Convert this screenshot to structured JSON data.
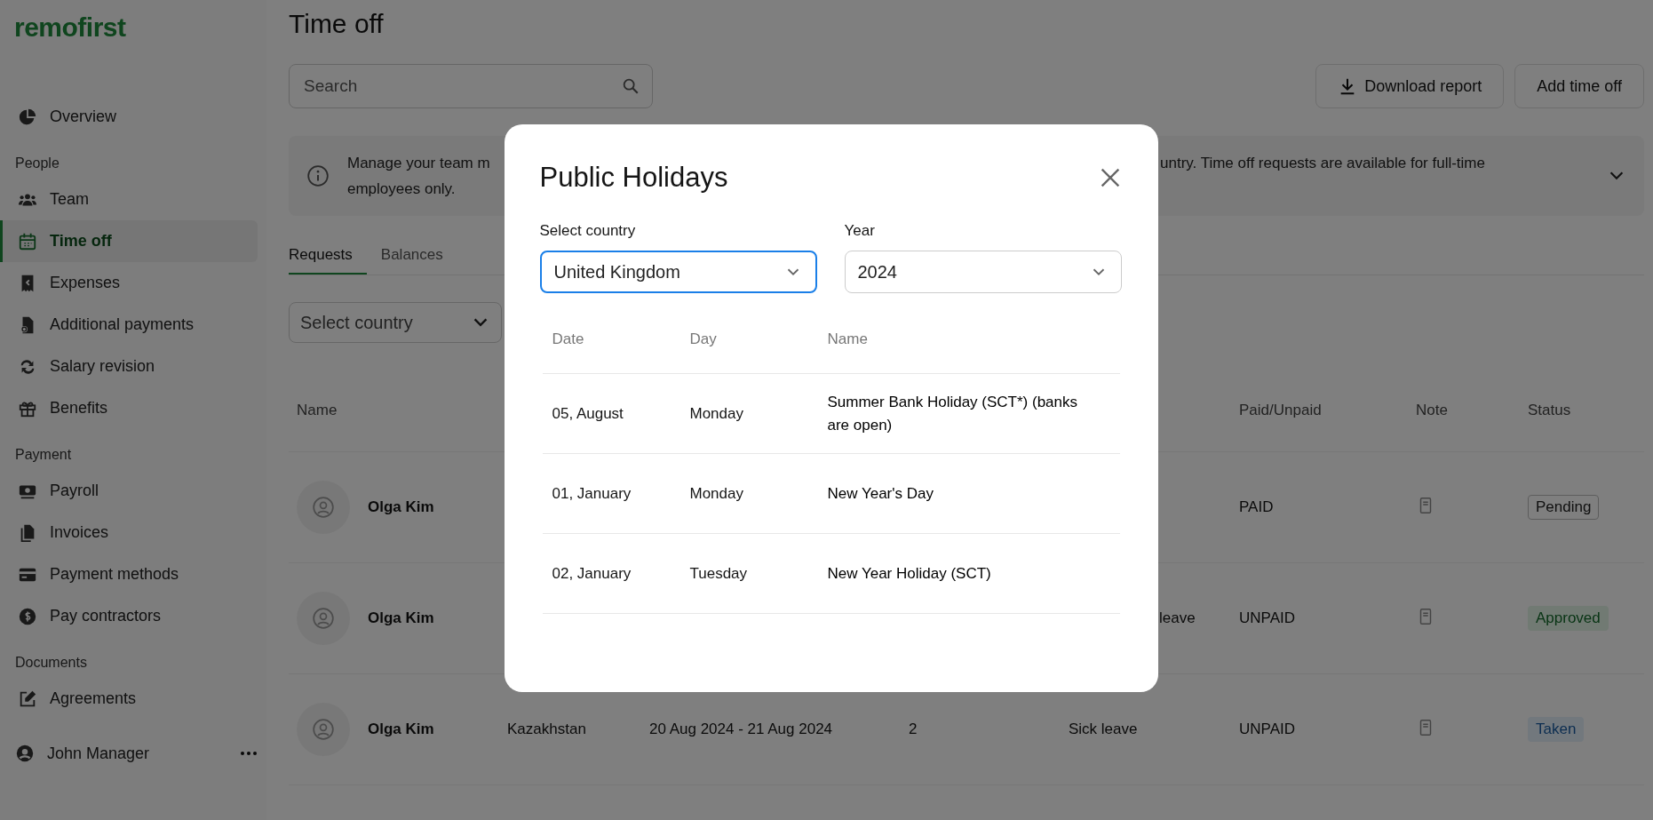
{
  "brand": {
    "logo": "remofirst"
  },
  "sidebar": {
    "sections": [
      {
        "items": [
          {
            "label": "Overview",
            "selected": false
          }
        ]
      },
      {
        "title": "People",
        "items": [
          {
            "label": "Team",
            "selected": false
          },
          {
            "label": "Time off",
            "selected": true
          },
          {
            "label": "Expenses",
            "selected": false
          },
          {
            "label": "Additional payments",
            "selected": false
          },
          {
            "label": "Salary revision",
            "selected": false
          },
          {
            "label": "Benefits",
            "selected": false
          }
        ]
      },
      {
        "title": "Payment",
        "items": [
          {
            "label": "Payroll",
            "selected": false
          },
          {
            "label": "Invoices",
            "selected": false
          },
          {
            "label": "Payment methods",
            "selected": false
          },
          {
            "label": "Pay contractors",
            "selected": false
          }
        ]
      },
      {
        "title": "Documents",
        "items": [
          {
            "label": "Agreements",
            "selected": false
          }
        ]
      }
    ],
    "user": {
      "name": "John Manager"
    }
  },
  "page": {
    "title": "Time off",
    "search": {
      "placeholder": "Search"
    },
    "buttons": [
      {
        "label": "Download report",
        "kind": "download"
      },
      {
        "label": "Add time off",
        "kind": "plain"
      }
    ],
    "banner": {
      "line1_start": "Manage your team m",
      "line1_end": "untry. Time off requests are available for full-time",
      "line2": "employees only."
    },
    "tabs": [
      {
        "label": "Requests",
        "selected": true
      },
      {
        "label": "Balances",
        "selected": false
      }
    ],
    "filter": {
      "placeholder": "Select country"
    }
  },
  "table": {
    "header": {
      "name": "Name",
      "paid": "Paid/Unpaid",
      "note": "Note",
      "status": "Status"
    },
    "rows": [
      {
        "name": "Olga Kim",
        "paid": "PAID",
        "status": "Pending",
        "kind": "pending"
      },
      {
        "name": "Olga Kim",
        "type": "leave",
        "type_cut": true,
        "paid": "UNPAID",
        "status": "Approved",
        "kind": "approved"
      },
      {
        "name": "Olga Kim",
        "country": "Kazakhstan",
        "dates": "20 Aug 2024 - 21 Aug 2024",
        "days": "2",
        "type": "Sick leave",
        "type_cut": false,
        "paid": "UNPAID",
        "status": "Taken",
        "kind": "taken"
      }
    ]
  },
  "modal": {
    "title": "Public Holidays",
    "country": {
      "label": "Select country",
      "value": "United Kingdom",
      "focused": true
    },
    "year": {
      "label": "Year",
      "value": "2024",
      "focused": false
    },
    "columns": [
      "Date",
      "Day",
      "Name"
    ],
    "rows": [
      {
        "date": "05, August",
        "day": "Monday",
        "name": "Summer Bank Holiday (SCT*) (banks are open)"
      },
      {
        "date": "01, January",
        "day": "Monday",
        "name": "New Year's Day"
      },
      {
        "date": "02, January",
        "day": "Tuesday",
        "name": "New Year Holiday (SCT)"
      }
    ]
  }
}
